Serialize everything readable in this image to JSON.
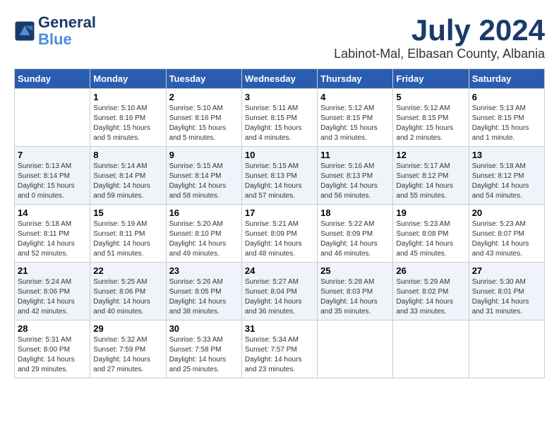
{
  "header": {
    "logo_line1": "General",
    "logo_line2": "Blue",
    "month": "July 2024",
    "location": "Labinot-Mal, Elbasan County, Albania"
  },
  "weekdays": [
    "Sunday",
    "Monday",
    "Tuesday",
    "Wednesday",
    "Thursday",
    "Friday",
    "Saturday"
  ],
  "weeks": [
    [
      {
        "day": "",
        "info": ""
      },
      {
        "day": "1",
        "info": "Sunrise: 5:10 AM\nSunset: 8:16 PM\nDaylight: 15 hours\nand 5 minutes."
      },
      {
        "day": "2",
        "info": "Sunrise: 5:10 AM\nSunset: 8:16 PM\nDaylight: 15 hours\nand 5 minutes."
      },
      {
        "day": "3",
        "info": "Sunrise: 5:11 AM\nSunset: 8:15 PM\nDaylight: 15 hours\nand 4 minutes."
      },
      {
        "day": "4",
        "info": "Sunrise: 5:12 AM\nSunset: 8:15 PM\nDaylight: 15 hours\nand 3 minutes."
      },
      {
        "day": "5",
        "info": "Sunrise: 5:12 AM\nSunset: 8:15 PM\nDaylight: 15 hours\nand 2 minutes."
      },
      {
        "day": "6",
        "info": "Sunrise: 5:13 AM\nSunset: 8:15 PM\nDaylight: 15 hours\nand 1 minute."
      }
    ],
    [
      {
        "day": "7",
        "info": "Sunrise: 5:13 AM\nSunset: 8:14 PM\nDaylight: 15 hours\nand 0 minutes."
      },
      {
        "day": "8",
        "info": "Sunrise: 5:14 AM\nSunset: 8:14 PM\nDaylight: 14 hours\nand 59 minutes."
      },
      {
        "day": "9",
        "info": "Sunrise: 5:15 AM\nSunset: 8:14 PM\nDaylight: 14 hours\nand 58 minutes."
      },
      {
        "day": "10",
        "info": "Sunrise: 5:15 AM\nSunset: 8:13 PM\nDaylight: 14 hours\nand 57 minutes."
      },
      {
        "day": "11",
        "info": "Sunrise: 5:16 AM\nSunset: 8:13 PM\nDaylight: 14 hours\nand 56 minutes."
      },
      {
        "day": "12",
        "info": "Sunrise: 5:17 AM\nSunset: 8:12 PM\nDaylight: 14 hours\nand 55 minutes."
      },
      {
        "day": "13",
        "info": "Sunrise: 5:18 AM\nSunset: 8:12 PM\nDaylight: 14 hours\nand 54 minutes."
      }
    ],
    [
      {
        "day": "14",
        "info": "Sunrise: 5:18 AM\nSunset: 8:11 PM\nDaylight: 14 hours\nand 52 minutes."
      },
      {
        "day": "15",
        "info": "Sunrise: 5:19 AM\nSunset: 8:11 PM\nDaylight: 14 hours\nand 51 minutes."
      },
      {
        "day": "16",
        "info": "Sunrise: 5:20 AM\nSunset: 8:10 PM\nDaylight: 14 hours\nand 49 minutes."
      },
      {
        "day": "17",
        "info": "Sunrise: 5:21 AM\nSunset: 8:09 PM\nDaylight: 14 hours\nand 48 minutes."
      },
      {
        "day": "18",
        "info": "Sunrise: 5:22 AM\nSunset: 8:09 PM\nDaylight: 14 hours\nand 46 minutes."
      },
      {
        "day": "19",
        "info": "Sunrise: 5:23 AM\nSunset: 8:08 PM\nDaylight: 14 hours\nand 45 minutes."
      },
      {
        "day": "20",
        "info": "Sunrise: 5:23 AM\nSunset: 8:07 PM\nDaylight: 14 hours\nand 43 minutes."
      }
    ],
    [
      {
        "day": "21",
        "info": "Sunrise: 5:24 AM\nSunset: 8:06 PM\nDaylight: 14 hours\nand 42 minutes."
      },
      {
        "day": "22",
        "info": "Sunrise: 5:25 AM\nSunset: 8:06 PM\nDaylight: 14 hours\nand 40 minutes."
      },
      {
        "day": "23",
        "info": "Sunrise: 5:26 AM\nSunset: 8:05 PM\nDaylight: 14 hours\nand 38 minutes."
      },
      {
        "day": "24",
        "info": "Sunrise: 5:27 AM\nSunset: 8:04 PM\nDaylight: 14 hours\nand 36 minutes."
      },
      {
        "day": "25",
        "info": "Sunrise: 5:28 AM\nSunset: 8:03 PM\nDaylight: 14 hours\nand 35 minutes."
      },
      {
        "day": "26",
        "info": "Sunrise: 5:29 AM\nSunset: 8:02 PM\nDaylight: 14 hours\nand 33 minutes."
      },
      {
        "day": "27",
        "info": "Sunrise: 5:30 AM\nSunset: 8:01 PM\nDaylight: 14 hours\nand 31 minutes."
      }
    ],
    [
      {
        "day": "28",
        "info": "Sunrise: 5:31 AM\nSunset: 8:00 PM\nDaylight: 14 hours\nand 29 minutes."
      },
      {
        "day": "29",
        "info": "Sunrise: 5:32 AM\nSunset: 7:59 PM\nDaylight: 14 hours\nand 27 minutes."
      },
      {
        "day": "30",
        "info": "Sunrise: 5:33 AM\nSunset: 7:58 PM\nDaylight: 14 hours\nand 25 minutes."
      },
      {
        "day": "31",
        "info": "Sunrise: 5:34 AM\nSunset: 7:57 PM\nDaylight: 14 hours\nand 23 minutes."
      },
      {
        "day": "",
        "info": ""
      },
      {
        "day": "",
        "info": ""
      },
      {
        "day": "",
        "info": ""
      }
    ]
  ]
}
